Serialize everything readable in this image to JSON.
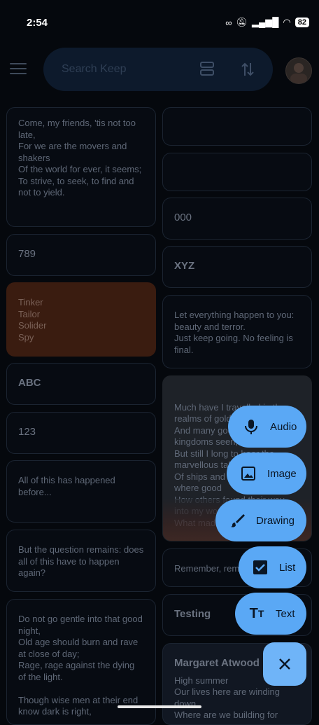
{
  "status": {
    "time": "2:54",
    "battery": "82"
  },
  "search": {
    "placeholder": "Search Keep"
  },
  "left_notes": [
    {
      "text": "Come, my friends, 'tis not too late,\nFor we are the movers and shakers\nOf the world for ever, it seems;\nTo strive, to seek, to find and not to yield."
    },
    {
      "text": "789"
    },
    {
      "text": "Tinker\nTailor\nSolider\nSpy"
    },
    {
      "text": "ABC"
    },
    {
      "text": "123"
    },
    {
      "text": "All of this has happened before..."
    },
    {
      "text": "But the question remains: does all of this have to happen again?"
    },
    {
      "text": "Do not go gentle into that good night,\nOld age should burn and rave at close of day;\nRage, rage against the dying of the light.\n\nThough wise men at their end know dark is right,"
    }
  ],
  "right_notes": [
    {
      "text": ""
    },
    {
      "text": ""
    },
    {
      "text": "000"
    },
    {
      "text": "XYZ"
    },
    {
      "text": "Let everything happen to you: beauty and terror.\nJust keep going. No feeling is final."
    },
    {
      "text": "Much have I travelled in the realms of gold,\nAnd many goodly states and kingdoms seen;\nBut still I long to hear the marvellous tales\nOf ships and seas and lands where good\nHow others found their way into my world.\nWhat made the struggle th"
    },
    {
      "text": "Remember, rem"
    },
    {
      "text": "Testing"
    },
    {
      "title": "Margaret Atwood",
      "text": "High summer\nOur lives here are winding down.\nWhere are we building for"
    }
  ],
  "fab": {
    "audio": "Audio",
    "image": "Image",
    "drawing": "Drawing",
    "list": "List",
    "text": "Text"
  }
}
